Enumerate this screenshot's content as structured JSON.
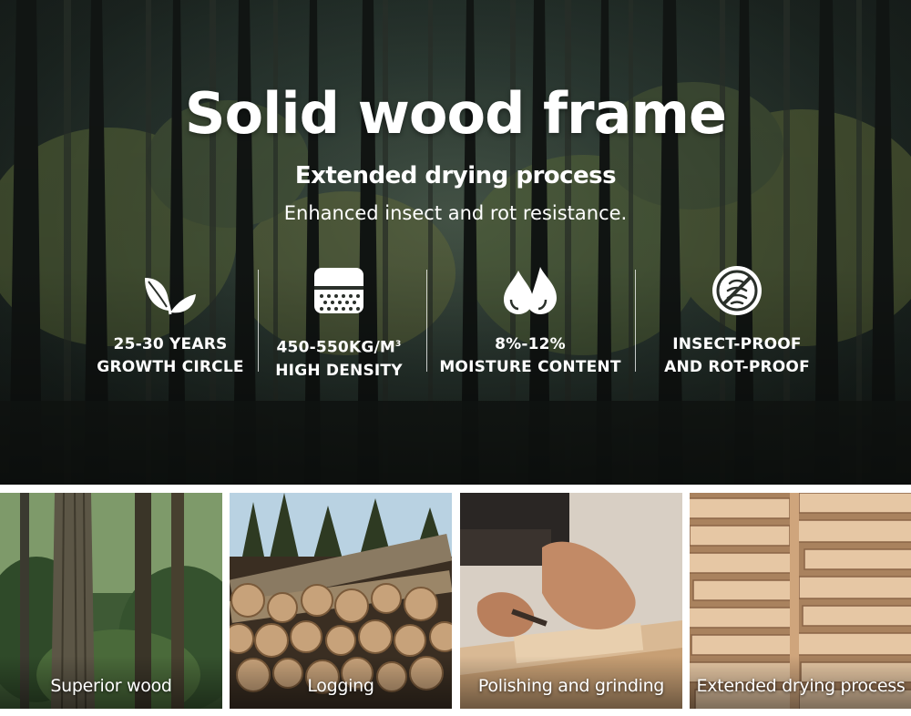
{
  "hero": {
    "title": "Solid wood frame",
    "subtitle": "Extended drying process",
    "tagline": "Enhanced insect and rot resistance."
  },
  "features": [
    {
      "icon": "leaf-icon",
      "line1": "25-30 YEARS",
      "line2": "GROWTH CIRCLE"
    },
    {
      "icon": "density-block-icon",
      "line1": "450-550KG/M",
      "line1_sup": "3",
      "line2": "HIGH DENSITY"
    },
    {
      "icon": "water-drops-icon",
      "line1": "8%-12%",
      "line2": "MOISTURE CONTENT"
    },
    {
      "icon": "no-insect-icon",
      "line1": "INSECT-PROOF",
      "line2": "AND ROT-PROOF"
    }
  ],
  "tiles": [
    {
      "caption": "Superior wood"
    },
    {
      "caption": "Logging"
    },
    {
      "caption": "Polishing and grinding"
    },
    {
      "caption": "Extended drying process"
    }
  ],
  "colors": {
    "text": "#ffffff",
    "forest_dark": "#1b2420",
    "wood_light": "#e3c4a3"
  }
}
